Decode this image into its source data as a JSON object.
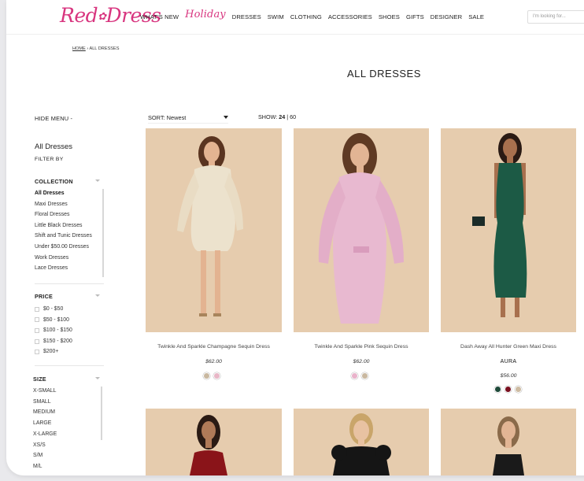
{
  "brand": {
    "logo_left": "Red",
    "logo_right": "Dress",
    "logo_flower": "✿"
  },
  "nav": {
    "items": [
      "WHAT'S NEW",
      "Holiday",
      "DRESSES",
      "SWIM",
      "CLOTHING",
      "ACCESSORIES",
      "SHOES",
      "GIFTS",
      "DESIGNER",
      "SALE"
    ],
    "search_placeholder": "I'm looking for..."
  },
  "breadcrumb": {
    "home": "HOME",
    "sep": "›",
    "current": "ALL DRESSES"
  },
  "page": {
    "title": "ALL DRESSES"
  },
  "toolbar": {
    "hide_menu": "HIDE MENU -",
    "sort_label": "SORT: Newest",
    "show_label": "SHOW:",
    "show_24": "24",
    "show_sep": "|",
    "show_60": "60"
  },
  "sidebar": {
    "heading": "All Dresses",
    "filter_by": "FILTER BY",
    "collection": {
      "title": "COLLECTION",
      "items": [
        "All Dresses",
        "Maxi Dresses",
        "Floral Dresses",
        "Little Black Dresses",
        "Shift and Tunic Dresses",
        "Under $50.00 Dresses",
        "Work Dresses",
        "Lace Dresses"
      ]
    },
    "price": {
      "title": "PRICE",
      "items": [
        "$0 - $50",
        "$50 - $100",
        "$100 - $150",
        "$150 - $200",
        "$200+"
      ]
    },
    "size": {
      "title": "SIZE",
      "items": [
        "X-SMALL",
        "SMALL",
        "MEDIUM",
        "LARGE",
        "X-LARGE",
        "XS/S",
        "S/M",
        "M/L"
      ]
    }
  },
  "products": [
    {
      "name": "Twinkle And Sparkle Champagne Sequin Dress",
      "price": "$62.00",
      "brand": "",
      "swatches": [
        "#c9b8a0",
        "#e8b7c7"
      ],
      "dress_color": "#e9dcc4"
    },
    {
      "name": "Twinkle And Sparkle Pink Sequin Dress",
      "price": "$62.00",
      "brand": "",
      "swatches": [
        "#e9b3cb",
        "#c9b8a0"
      ],
      "dress_color": "#e7b6cf"
    },
    {
      "name": "Dash Away All Hunter Green Maxi Dress",
      "price": "$56.00",
      "brand": "AURA",
      "swatches": [
        "#1f4a3a",
        "#7a1020",
        "#cdbba2"
      ],
      "dress_color": "#1c5a45"
    }
  ],
  "row2_colors": [
    "#8a1419",
    "#111111",
    "#1a1a1a"
  ]
}
